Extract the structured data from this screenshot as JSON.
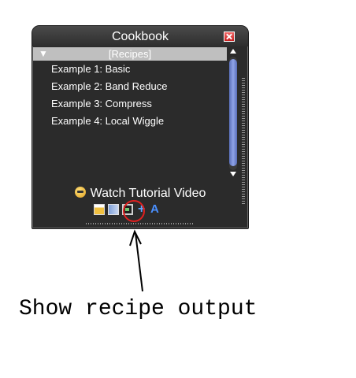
{
  "panel": {
    "title": "Cookbook",
    "group_label": "[Recipes]",
    "recipes": [
      "Example 1: Basic",
      "Example 2: Band Reduce",
      "Example 3: Compress",
      "Example 4: Local Wiggle"
    ],
    "tutorial_label": "Watch Tutorial Video",
    "toolbar": {
      "add_symbol": "+",
      "font_symbol": "A"
    }
  },
  "annotation": {
    "callout_text": "Show recipe output",
    "highlight_color": "#e02020"
  },
  "colors": {
    "panel_bg": "#2b2b2b",
    "group_row_bg": "#bfbfbf",
    "scroll_thumb": "#8fa3e8",
    "close_button": "#c81e1e"
  },
  "icons": [
    "close-icon",
    "expand-triangle-icon",
    "scroll-up-icon",
    "scroll-down-icon",
    "tutorial-smiley-icon",
    "edit-recipe-icon",
    "recipe-book-icon",
    "show-output-icon",
    "add-icon",
    "font-icon"
  ]
}
